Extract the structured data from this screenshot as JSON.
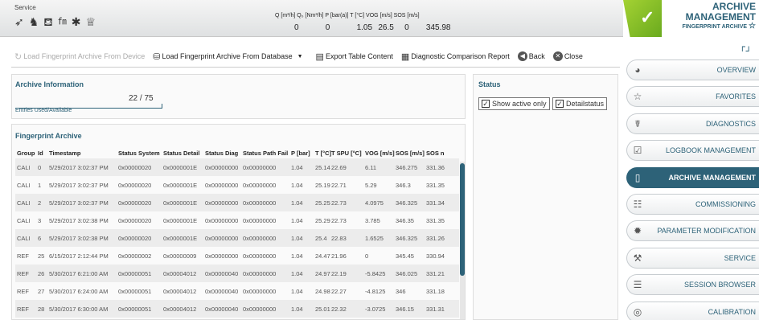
{
  "service": {
    "label": "Service",
    "icons": [
      "flow-icon",
      "person-icon",
      "tap-icon",
      "ft-tools-icon",
      "gear-icon",
      "award-icon"
    ]
  },
  "readings": {
    "labels": "Q [m³/h]  Q₀ [Nm³/h]  P [bar(a)]  T [°C]  VOG [m/s]  SOS [m/s]",
    "values": [
      "0",
      "0",
      "1.05",
      "26.5",
      "0",
      "345.98"
    ]
  },
  "header": {
    "title1": "ARCHIVE",
    "title2": "MANAGEMENT",
    "subtitle": "FINGERPRINT ARCHIVE",
    "status_color": "#8cc63f",
    "accent": "#2d6278"
  },
  "toolbar": {
    "load_device": "Load Fingerprint Archive From Device",
    "load_database": "Load Fingerprint Archive From Database",
    "export": "Export Table Content",
    "diagnostic": "Diagnostic Comparison Report",
    "back": "Back",
    "close": "Close"
  },
  "archive_info": {
    "title": "Archive Information",
    "entries_value": "22 / 75",
    "entries_label": "Entries Used/Available"
  },
  "status": {
    "title": "Status",
    "show_active_only": "Show active only",
    "detail_status": "Detailstatus"
  },
  "fingerprint": {
    "title": "Fingerprint Archive",
    "columns": [
      "Group",
      "Id",
      "Timestamp",
      "Status System",
      "Status Detail",
      "Status Diag",
      "Status Path Fail",
      "P [bar]",
      "T [°C]",
      "T SPU [°C]",
      "VOG [m/s]",
      "SOS [m/s]",
      "SOS n"
    ],
    "rows": [
      [
        "CALI",
        "0",
        "5/29/2017 3:02:37 PM",
        "0x00000020",
        "0x0000001E",
        "0x00000000",
        "0x00000000",
        "1.04",
        "25.14",
        "22.69",
        "6.11",
        "346.275",
        "331.36"
      ],
      [
        "CALI",
        "1",
        "5/29/2017 3:02:37 PM",
        "0x00000020",
        "0x0000001E",
        "0x00000000",
        "0x00000000",
        "1.04",
        "25.19",
        "22.71",
        "5.29",
        "346.3",
        "331.35"
      ],
      [
        "CALI",
        "2",
        "5/29/2017 3:02:37 PM",
        "0x00000020",
        "0x0000001E",
        "0x00000000",
        "0x00000000",
        "1.04",
        "25.25",
        "22.73",
        "4.0975",
        "346.325",
        "331.34"
      ],
      [
        "CALI",
        "3",
        "5/29/2017 3:02:38 PM",
        "0x00000020",
        "0x0000001E",
        "0x00000000",
        "0x00000000",
        "1.04",
        "25.29",
        "22.73",
        "3.785",
        "346.35",
        "331.35"
      ],
      [
        "CALI",
        "6",
        "5/29/2017 3:02:38 PM",
        "0x00000020",
        "0x0000001E",
        "0x00000000",
        "0x00000000",
        "1.04",
        "25.4",
        "22.83",
        "1.6525",
        "346.325",
        "331.26"
      ],
      [
        "REF",
        "25",
        "6/15/2017 2:12:44 PM",
        "0x00000002",
        "0x00000009",
        "0x00000000",
        "0x00000000",
        "1.04",
        "24.47",
        "21.96",
        "0",
        "345.45",
        "330.94"
      ],
      [
        "REF",
        "26",
        "5/30/2017 6:21:00 AM",
        "0x00000051",
        "0x00004012",
        "0x00000040",
        "0x00000000",
        "1.04",
        "24.97",
        "22.19",
        "-5.8425",
        "346.025",
        "331.21"
      ],
      [
        "REF",
        "27",
        "5/30/2017 6:24:00 AM",
        "0x00000051",
        "0x00004012",
        "0x00000040",
        "0x00000000",
        "1.04",
        "24.98",
        "22.27",
        "-4.8125",
        "346",
        "331.18"
      ],
      [
        "REF",
        "28",
        "5/30/2017 6:30:00 AM",
        "0x00000051",
        "0x00004012",
        "0x00000040",
        "0x00000000",
        "1.04",
        "25.01",
        "22.32",
        "-3.0725",
        "346.15",
        "331.31"
      ],
      [
        "REF",
        "29",
        "5/30/2017 6:42:00 AM",
        "0x00000051",
        "0x00004012",
        "0x00000040",
        "0x00000000",
        "1.04",
        "25.09",
        "22.45",
        "-3.14",
        "346.1",
        "331.22"
      ]
    ]
  },
  "nav": {
    "items": [
      {
        "label": "OVERVIEW",
        "icon": "globe-icon",
        "active": false
      },
      {
        "label": "FAVORITES",
        "icon": "star-icon",
        "active": false
      },
      {
        "label": "DIAGNOSTICS",
        "icon": "stethoscope-icon",
        "active": false
      },
      {
        "label": "LOGBOOK MANAGEMENT",
        "icon": "logbook-icon",
        "active": false
      },
      {
        "label": "ARCHIVE MANAGEMENT",
        "icon": "archive-icon",
        "active": true
      },
      {
        "label": "COMMISSIONING",
        "icon": "checklist-icon",
        "active": false
      },
      {
        "label": "PARAMETER MODIFICATION",
        "icon": "gear-icon",
        "active": false
      },
      {
        "label": "SERVICE",
        "icon": "wrench-icon",
        "active": false
      },
      {
        "label": "SESSION BROWSER",
        "icon": "session-list-icon",
        "active": false
      },
      {
        "label": "CALIBRATION",
        "icon": "target-icon",
        "active": false
      }
    ]
  }
}
